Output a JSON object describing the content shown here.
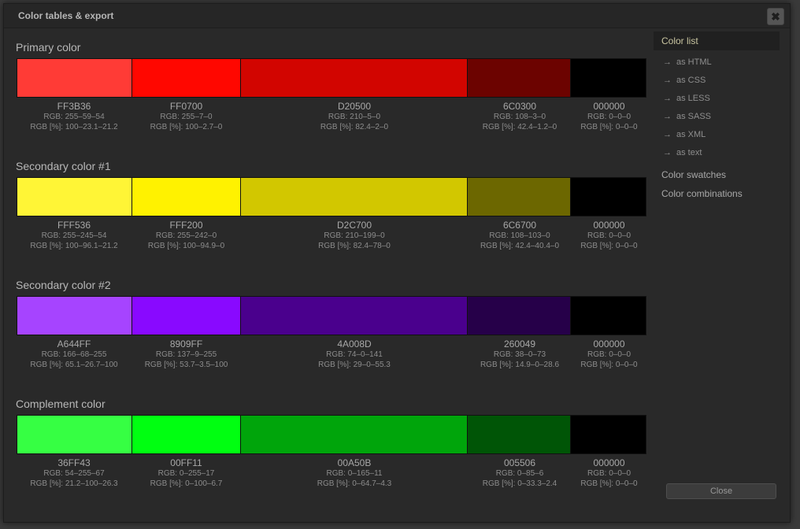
{
  "window": {
    "title": "Color tables & export",
    "close_icon": "✖"
  },
  "sections": [
    {
      "title": "Primary color",
      "swatches": [
        {
          "hex": "FF3B36",
          "color": "#FF3B36",
          "rgb": "RGB: 255–59–54",
          "rgb_pct": "RGB [%]: 100–23.1–21.2"
        },
        {
          "hex": "FF0700",
          "color": "#FF0700",
          "rgb": "RGB: 255–7–0",
          "rgb_pct": "RGB [%]: 100–2.7–0"
        },
        {
          "hex": "D20500",
          "color": "#D20500",
          "rgb": "RGB: 210–5–0",
          "rgb_pct": "RGB [%]: 82.4–2–0"
        },
        {
          "hex": "6C0300",
          "color": "#6C0300",
          "rgb": "RGB: 108–3–0",
          "rgb_pct": "RGB [%]: 42.4–1.2–0"
        },
        {
          "hex": "000000",
          "color": "#000000",
          "rgb": "RGB: 0–0–0",
          "rgb_pct": "RGB [%]: 0–0–0"
        }
      ]
    },
    {
      "title": "Secondary color #1",
      "swatches": [
        {
          "hex": "FFF536",
          "color": "#FFF536",
          "rgb": "RGB: 255–245–54",
          "rgb_pct": "RGB [%]: 100–96.1–21.2"
        },
        {
          "hex": "FFF200",
          "color": "#FFF200",
          "rgb": "RGB: 255–242–0",
          "rgb_pct": "RGB [%]: 100–94.9–0"
        },
        {
          "hex": "D2C700",
          "color": "#D2C700",
          "rgb": "RGB: 210–199–0",
          "rgb_pct": "RGB [%]: 82.4–78–0"
        },
        {
          "hex": "6C6700",
          "color": "#6C6700",
          "rgb": "RGB: 108–103–0",
          "rgb_pct": "RGB [%]: 42.4–40.4–0"
        },
        {
          "hex": "000000",
          "color": "#000000",
          "rgb": "RGB: 0–0–0",
          "rgb_pct": "RGB [%]: 0–0–0"
        }
      ]
    },
    {
      "title": "Secondary color #2",
      "swatches": [
        {
          "hex": "A644FF",
          "color": "#A644FF",
          "rgb": "RGB: 166–68–255",
          "rgb_pct": "RGB [%]: 65.1–26.7–100"
        },
        {
          "hex": "8909FF",
          "color": "#8909FF",
          "rgb": "RGB: 137–9–255",
          "rgb_pct": "RGB [%]: 53.7–3.5–100"
        },
        {
          "hex": "4A008D",
          "color": "#4A008D",
          "rgb": "RGB: 74–0–141",
          "rgb_pct": "RGB [%]: 29–0–55.3"
        },
        {
          "hex": "260049",
          "color": "#260049",
          "rgb": "RGB: 38–0–73",
          "rgb_pct": "RGB [%]: 14.9–0–28.6"
        },
        {
          "hex": "000000",
          "color": "#000000",
          "rgb": "RGB: 0–0–0",
          "rgb_pct": "RGB [%]: 0–0–0"
        }
      ]
    },
    {
      "title": "Complement color",
      "swatches": [
        {
          "hex": "36FF43",
          "color": "#36FF43",
          "rgb": "RGB: 54–255–67",
          "rgb_pct": "RGB [%]: 21.2–100–26.3"
        },
        {
          "hex": "00FF11",
          "color": "#00FF11",
          "rgb": "RGB: 0–255–17",
          "rgb_pct": "RGB [%]: 0–100–6.7"
        },
        {
          "hex": "00A50B",
          "color": "#00A50B",
          "rgb": "RGB: 0–165–11",
          "rgb_pct": "RGB [%]: 0–64.7–4.3"
        },
        {
          "hex": "005506",
          "color": "#005506",
          "rgb": "RGB: 0–85–6",
          "rgb_pct": "RGB [%]: 0–33.3–2.4"
        },
        {
          "hex": "000000",
          "color": "#000000",
          "rgb": "RGB: 0–0–0",
          "rgb_pct": "RGB [%]: 0–0–0"
        }
      ]
    }
  ],
  "sidebar": {
    "active": "Color list",
    "arrow_glyph": "→",
    "submenu": [
      "as HTML",
      "as CSS",
      "as LESS",
      "as SASS",
      "as XML",
      "as text"
    ],
    "items": [
      "Color swatches",
      "Color combinations"
    ]
  },
  "footer": {
    "close_label": "Close"
  }
}
